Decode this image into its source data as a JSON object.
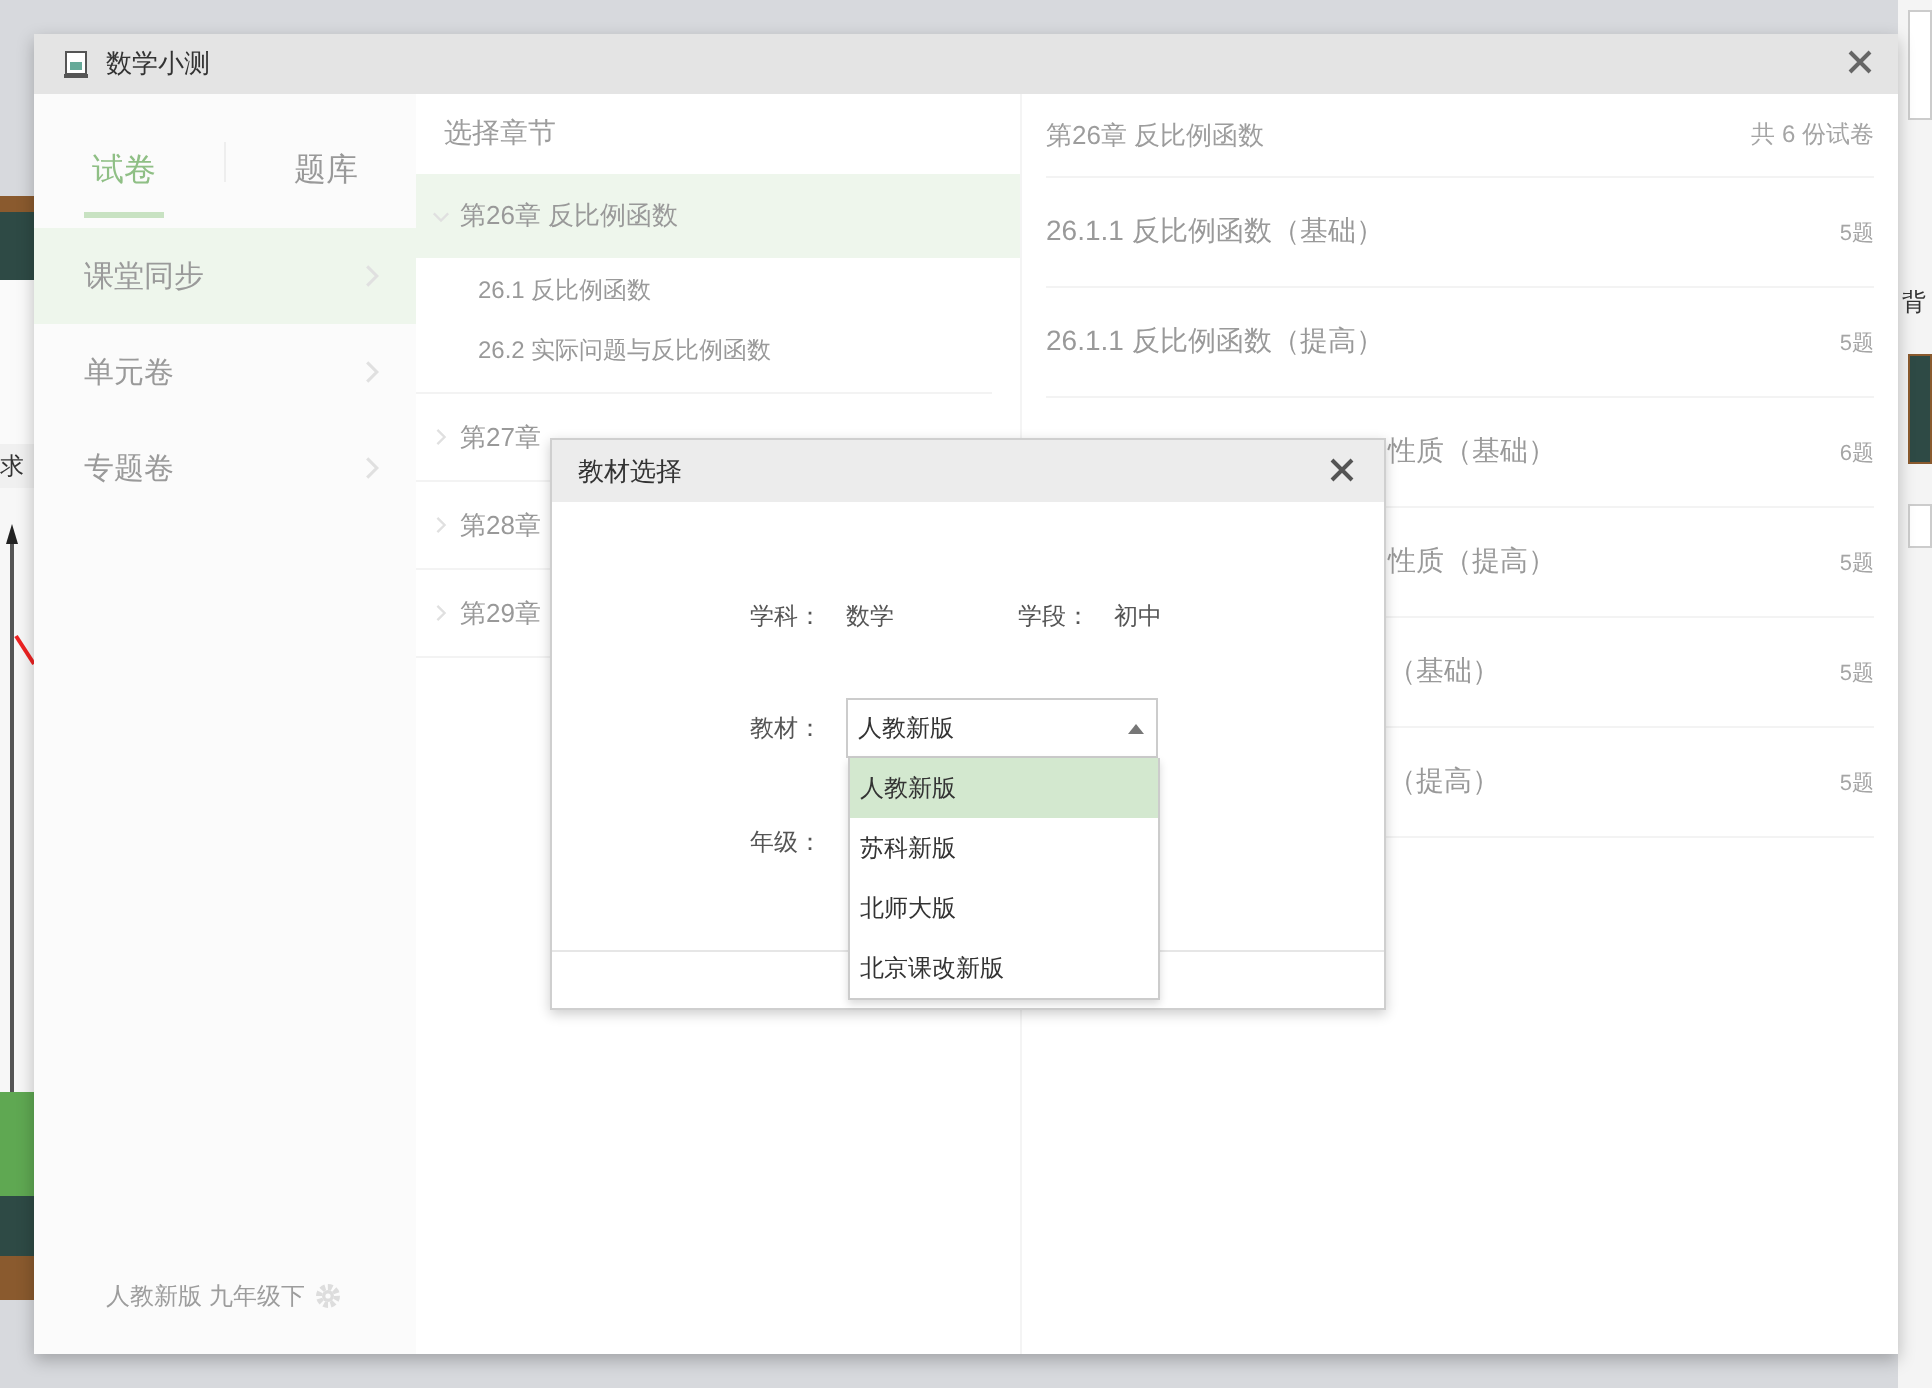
{
  "window": {
    "title": "数学小测"
  },
  "sidebar": {
    "tabs": [
      {
        "label": "试卷",
        "selected": true
      },
      {
        "label": "题库",
        "selected": false
      }
    ],
    "items": [
      {
        "label": "课堂同步",
        "selected": true
      },
      {
        "label": "单元卷",
        "selected": false
      },
      {
        "label": "专题卷",
        "selected": false
      }
    ],
    "footer": "人教新版 九年级下"
  },
  "chapters": {
    "header": "选择章节",
    "items": [
      {
        "label": "第26章 反比例函数",
        "expanded": true,
        "selected": true,
        "children": [
          {
            "label": "26.1 反比例函数"
          },
          {
            "label": "26.2 实际问题与反比例函数"
          }
        ]
      },
      {
        "label": "第27章",
        "expanded": false,
        "selected": false
      },
      {
        "label": "第28章",
        "expanded": false,
        "selected": false
      },
      {
        "label": "第29章",
        "expanded": false,
        "selected": false
      }
    ]
  },
  "papers": {
    "title": "第26章 反比例函数",
    "count": "共 6 份试卷",
    "rows": [
      {
        "title": "26.1.1 反比例函数（基础）",
        "count": "5题",
        "covered": false
      },
      {
        "title": "26.1.1 反比例函数（提高）",
        "count": "5题",
        "covered": false
      },
      {
        "title": "性质（基础）",
        "count": "6题",
        "covered": true
      },
      {
        "title": "性质（提高）",
        "count": "5题",
        "covered": true
      },
      {
        "title": "（基础）",
        "count": "5题",
        "covered": true
      },
      {
        "title": "（提高）",
        "count": "5题",
        "covered": true
      }
    ]
  },
  "dialog": {
    "title": "教材选择",
    "fields": [
      {
        "label": "学科：",
        "value": "数学"
      },
      {
        "label": "学段：",
        "value": "初中"
      }
    ],
    "textbook": {
      "label": "教材：",
      "value": "人教新版",
      "open": true,
      "options": [
        {
          "label": "人教新版",
          "selected": true
        },
        {
          "label": "苏科新版",
          "selected": false
        },
        {
          "label": "北师大版",
          "selected": false
        },
        {
          "label": "北京课改新版",
          "selected": false
        }
      ]
    },
    "grade": {
      "label": "年级："
    }
  },
  "background": {
    "left_label": "求",
    "right_label": "背"
  }
}
